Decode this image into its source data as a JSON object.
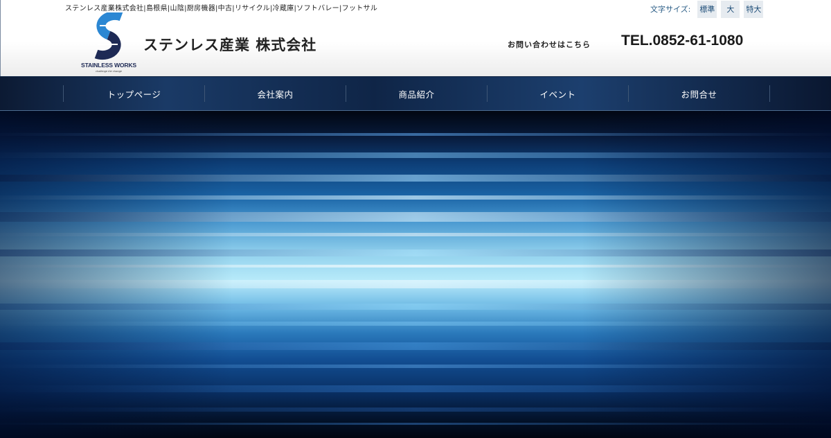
{
  "header": {
    "tagline": "ステンレス産業株式会社|島根県|山陰|厨房機器|中古|リサイクル|冷蔵庫|ソフトバレー|フットサル",
    "logo": {
      "text": "STAINLESS WORKS",
      "subtext": "challenge the change"
    },
    "company_name": "ステンレス産業 株式会社",
    "font_size": {
      "label": "文字サイズ:",
      "options": [
        "標準",
        "大",
        "特大"
      ]
    },
    "contact_label": "お問い合わせはこちら",
    "tel": "TEL.0852-61-1080"
  },
  "nav": {
    "items": [
      "トップページ",
      "会社案内",
      "商品紹介",
      "イベント",
      "お問合せ"
    ]
  },
  "colors": {
    "logo_blue": "#2b87d3",
    "logo_navy": "#1e2a55",
    "nav_bg": "#0f2547",
    "hero_highlight": "#b9ebfa"
  }
}
